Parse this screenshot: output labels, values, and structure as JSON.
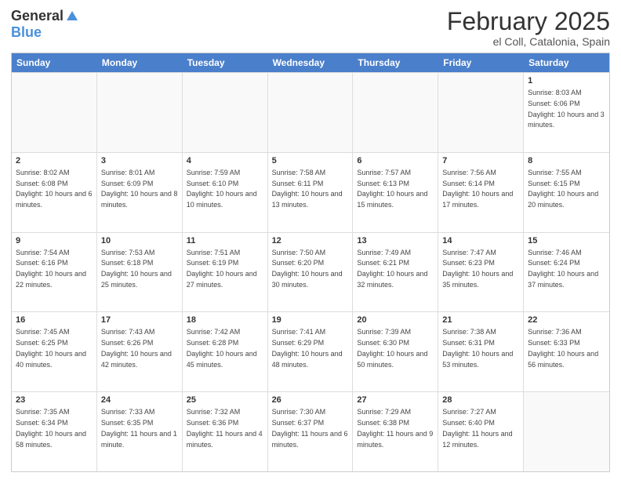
{
  "logo": {
    "general": "General",
    "blue": "Blue"
  },
  "title": "February 2025",
  "location": "el Coll, Catalonia, Spain",
  "days": [
    "Sunday",
    "Monday",
    "Tuesday",
    "Wednesday",
    "Thursday",
    "Friday",
    "Saturday"
  ],
  "weeks": [
    [
      {
        "day": "",
        "text": ""
      },
      {
        "day": "",
        "text": ""
      },
      {
        "day": "",
        "text": ""
      },
      {
        "day": "",
        "text": ""
      },
      {
        "day": "",
        "text": ""
      },
      {
        "day": "",
        "text": ""
      },
      {
        "day": "1",
        "text": "Sunrise: 8:03 AM\nSunset: 6:06 PM\nDaylight: 10 hours and 3 minutes."
      }
    ],
    [
      {
        "day": "2",
        "text": "Sunrise: 8:02 AM\nSunset: 6:08 PM\nDaylight: 10 hours and 6 minutes."
      },
      {
        "day": "3",
        "text": "Sunrise: 8:01 AM\nSunset: 6:09 PM\nDaylight: 10 hours and 8 minutes."
      },
      {
        "day": "4",
        "text": "Sunrise: 7:59 AM\nSunset: 6:10 PM\nDaylight: 10 hours and 10 minutes."
      },
      {
        "day": "5",
        "text": "Sunrise: 7:58 AM\nSunset: 6:11 PM\nDaylight: 10 hours and 13 minutes."
      },
      {
        "day": "6",
        "text": "Sunrise: 7:57 AM\nSunset: 6:13 PM\nDaylight: 10 hours and 15 minutes."
      },
      {
        "day": "7",
        "text": "Sunrise: 7:56 AM\nSunset: 6:14 PM\nDaylight: 10 hours and 17 minutes."
      },
      {
        "day": "8",
        "text": "Sunrise: 7:55 AM\nSunset: 6:15 PM\nDaylight: 10 hours and 20 minutes."
      }
    ],
    [
      {
        "day": "9",
        "text": "Sunrise: 7:54 AM\nSunset: 6:16 PM\nDaylight: 10 hours and 22 minutes."
      },
      {
        "day": "10",
        "text": "Sunrise: 7:53 AM\nSunset: 6:18 PM\nDaylight: 10 hours and 25 minutes."
      },
      {
        "day": "11",
        "text": "Sunrise: 7:51 AM\nSunset: 6:19 PM\nDaylight: 10 hours and 27 minutes."
      },
      {
        "day": "12",
        "text": "Sunrise: 7:50 AM\nSunset: 6:20 PM\nDaylight: 10 hours and 30 minutes."
      },
      {
        "day": "13",
        "text": "Sunrise: 7:49 AM\nSunset: 6:21 PM\nDaylight: 10 hours and 32 minutes."
      },
      {
        "day": "14",
        "text": "Sunrise: 7:47 AM\nSunset: 6:23 PM\nDaylight: 10 hours and 35 minutes."
      },
      {
        "day": "15",
        "text": "Sunrise: 7:46 AM\nSunset: 6:24 PM\nDaylight: 10 hours and 37 minutes."
      }
    ],
    [
      {
        "day": "16",
        "text": "Sunrise: 7:45 AM\nSunset: 6:25 PM\nDaylight: 10 hours and 40 minutes."
      },
      {
        "day": "17",
        "text": "Sunrise: 7:43 AM\nSunset: 6:26 PM\nDaylight: 10 hours and 42 minutes."
      },
      {
        "day": "18",
        "text": "Sunrise: 7:42 AM\nSunset: 6:28 PM\nDaylight: 10 hours and 45 minutes."
      },
      {
        "day": "19",
        "text": "Sunrise: 7:41 AM\nSunset: 6:29 PM\nDaylight: 10 hours and 48 minutes."
      },
      {
        "day": "20",
        "text": "Sunrise: 7:39 AM\nSunset: 6:30 PM\nDaylight: 10 hours and 50 minutes."
      },
      {
        "day": "21",
        "text": "Sunrise: 7:38 AM\nSunset: 6:31 PM\nDaylight: 10 hours and 53 minutes."
      },
      {
        "day": "22",
        "text": "Sunrise: 7:36 AM\nSunset: 6:33 PM\nDaylight: 10 hours and 56 minutes."
      }
    ],
    [
      {
        "day": "23",
        "text": "Sunrise: 7:35 AM\nSunset: 6:34 PM\nDaylight: 10 hours and 58 minutes."
      },
      {
        "day": "24",
        "text": "Sunrise: 7:33 AM\nSunset: 6:35 PM\nDaylight: 11 hours and 1 minute."
      },
      {
        "day": "25",
        "text": "Sunrise: 7:32 AM\nSunset: 6:36 PM\nDaylight: 11 hours and 4 minutes."
      },
      {
        "day": "26",
        "text": "Sunrise: 7:30 AM\nSunset: 6:37 PM\nDaylight: 11 hours and 6 minutes."
      },
      {
        "day": "27",
        "text": "Sunrise: 7:29 AM\nSunset: 6:38 PM\nDaylight: 11 hours and 9 minutes."
      },
      {
        "day": "28",
        "text": "Sunrise: 7:27 AM\nSunset: 6:40 PM\nDaylight: 11 hours and 12 minutes."
      },
      {
        "day": "",
        "text": ""
      }
    ]
  ]
}
